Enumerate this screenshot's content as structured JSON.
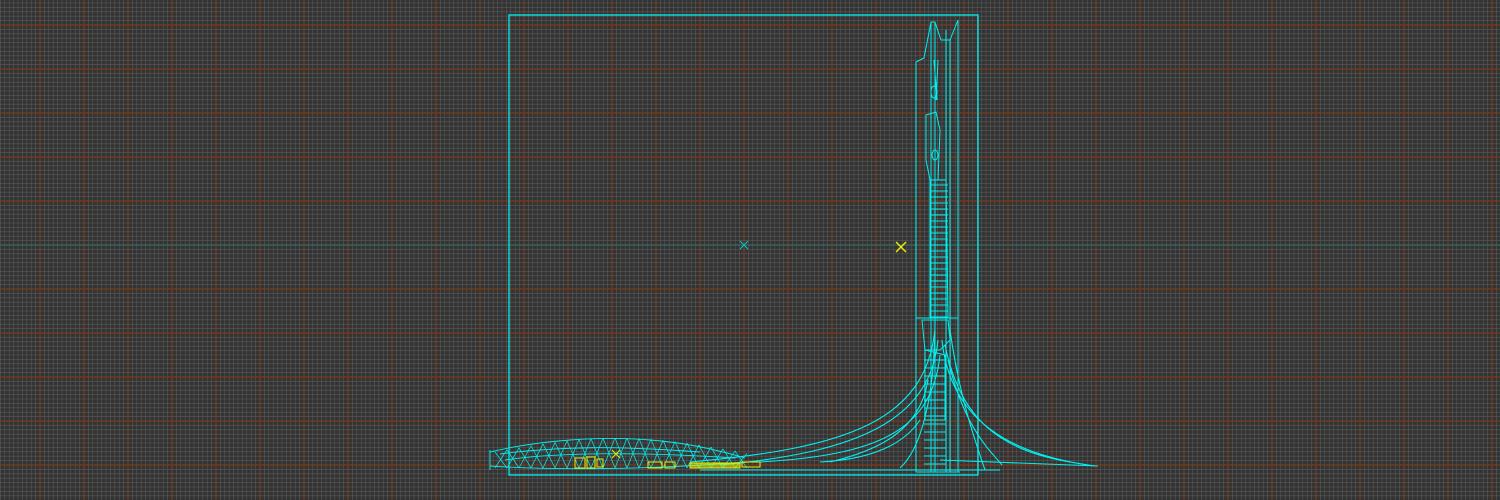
{
  "viewport": {
    "name": "wireframe-viewport",
    "background_color": "#333333",
    "grid": {
      "visible": true,
      "minor_color": "#5a5a5a",
      "major_color": "#7a3a1a",
      "axis_color": "#2e6a6a"
    },
    "colors": {
      "wireframe": "#00f0f0",
      "selected": "#f0f000",
      "pivot_marker": "#00c8c8",
      "light_marker": "#f0f000"
    }
  }
}
